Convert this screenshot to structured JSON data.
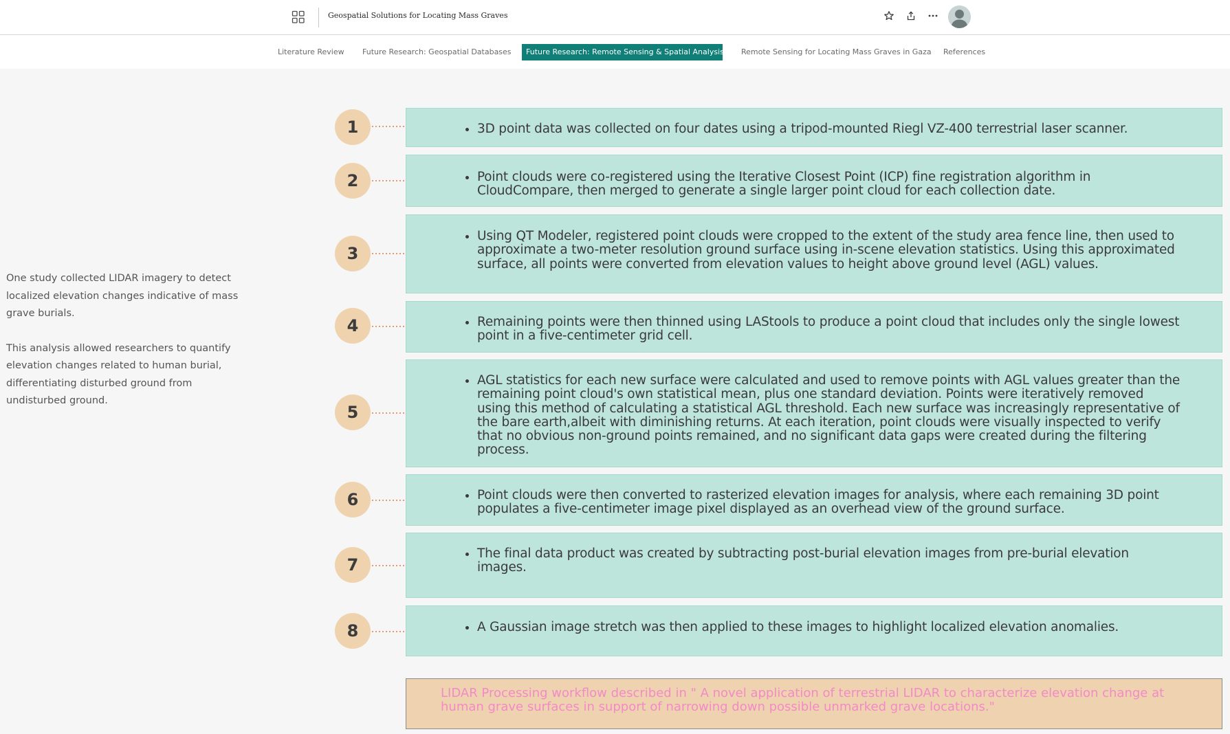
{
  "header": {
    "title": "Geospatial Solutions for Locating Mass Graves",
    "icons": [
      "apps-grid-icon",
      "star-icon",
      "share-icon",
      "more-icon",
      "avatar"
    ]
  },
  "nav": {
    "items": [
      {
        "label": "Literature Review",
        "active": false
      },
      {
        "label": "Future Research: Geospatial Databases",
        "active": false
      },
      {
        "label": "Future Research: Remote Sensing & Spatial Analysis...",
        "active": true
      },
      {
        "label": "Remote Sensing for Locating Mass Graves in Gaza",
        "active": false
      },
      {
        "label": "References",
        "active": false
      }
    ]
  },
  "side_text": {
    "paragraph1": "One study collected LIDAR imagery to detect localized elevation changes indicative of mass grave burials.",
    "paragraph2": "This analysis allowed researchers to quantify elevation changes related to human burial, differentiating disturbed ground from undisturbed ground."
  },
  "steps": [
    {
      "number": "1",
      "text": "3D point data was collected on four dates using a tripod-mounted Riegl  VZ-400 terrestrial laser scanner."
    },
    {
      "number": "2",
      "text": "Point clouds were co-registered using the Iterative Closest Point (ICP) fine registration algorithm in CloudCompare, then merged to generate a single larger point cloud for each collection date."
    },
    {
      "number": "3",
      "text": "Using QT Modeler, registered point clouds were cropped to the extent of the study area fence line, then used to approximate a two-meter resolution ground surface using in-scene elevation statistics. Using this approximated surface, all points were converted from elevation values to height above ground level (AGL) values."
    },
    {
      "number": "4",
      "text": "Remaining points were then thinned using LAStools to produce a point cloud that includes only the single lowest point in a five-centimeter grid cell."
    },
    {
      "number": "5",
      "text": "AGL statistics for each new surface were calculated and used to remove points with AGL values greater than the remaining point cloud's own statistical mean, plus one standard deviation. Points were iteratively removed using this method of calculating a statistical AGL threshold. Each new surface was increasingly representative of the bare earth,albeit with diminishing returns. At each iteration, point clouds were visually inspected to verify that no obvious non-ground points remained, and no significant data gaps were created during the filtering process."
    },
    {
      "number": "6",
      "text": "Point clouds were then converted to rasterized elevation images for analysis, where each remaining 3D point populates a five-centimeter image pixel displayed as an overhead view of the ground surface."
    },
    {
      "number": "7",
      "text": "The final data product was created by subtracting post-burial elevation images from pre-burial elevation images."
    },
    {
      "number": "8",
      "text": "A Gaussian image stretch was then applied to these images to highlight localized elevation anomalies."
    }
  ],
  "caption": "LIDAR Processing workflow described in \" A novel application of terrestrial LIDAR to characterize elevation change at human grave surfaces in support of narrowing down possible unmarked grave locations.\"",
  "colors": {
    "accent": "#0f7f78",
    "step_box": "#bee5dc",
    "step_circle": "#eed3ae",
    "connector": "#dc9c78",
    "caption_bg": "#efd3b1",
    "caption_text": "#f28ac6"
  }
}
